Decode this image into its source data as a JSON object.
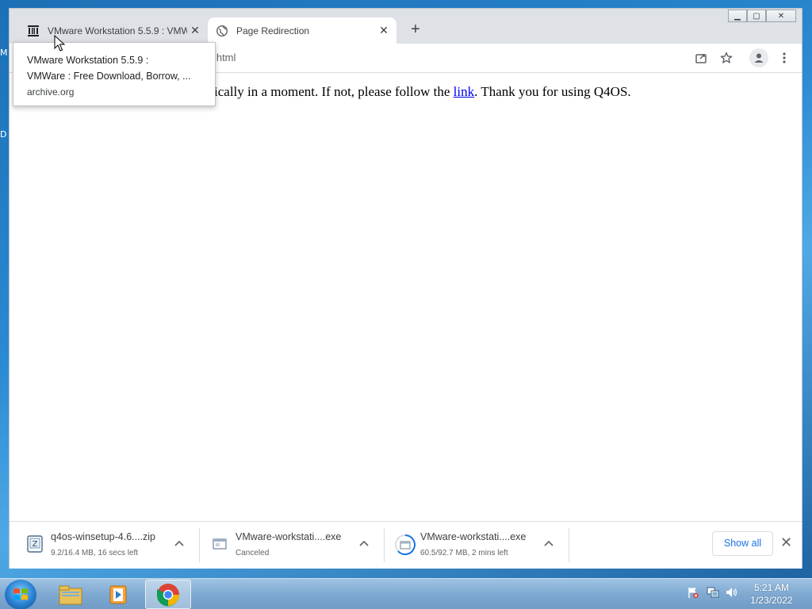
{
  "desktop": {
    "labels": [
      "M",
      "D"
    ]
  },
  "window": {
    "controls": {
      "minimize": "▁",
      "maximize": "▢",
      "close": "✕"
    }
  },
  "tabs": [
    {
      "title": "VMware Workstation 5.5.9 : VMW",
      "icon": "archive-icon",
      "close": "✕"
    },
    {
      "title": "Page Redirection",
      "icon": "globe-icon",
      "close": "✕"
    }
  ],
  "new_tab": "+",
  "omnibox": {
    "url_fragment": "1.html"
  },
  "tooltip": {
    "title_line1": "VMware Workstation 5.5.9 :",
    "title_line2": "VMWare : Free Download, Borrow, ...",
    "domain": "archive.org"
  },
  "page": {
    "text_before": "ically in a moment. If not, please follow the ",
    "link_text": "link",
    "text_after": ". Thank you for using Q4OS."
  },
  "downloads": [
    {
      "name": "q4os-winsetup-4.6....zip",
      "status": "9.2/16.4 MB, 16 secs left",
      "icon": "zip-file-icon"
    },
    {
      "name": "VMware-workstati....exe",
      "status": "Canceled",
      "icon": "exe-file-icon"
    },
    {
      "name": "VMware-workstati....exe",
      "status": "60.5/92.7 MB, 2 mins left",
      "icon": "exe-file-icon"
    }
  ],
  "download_bar": {
    "show_all": "Show all",
    "close": "✕"
  },
  "taskbar": {
    "time": "5:21 AM",
    "date": "1/23/2022"
  }
}
